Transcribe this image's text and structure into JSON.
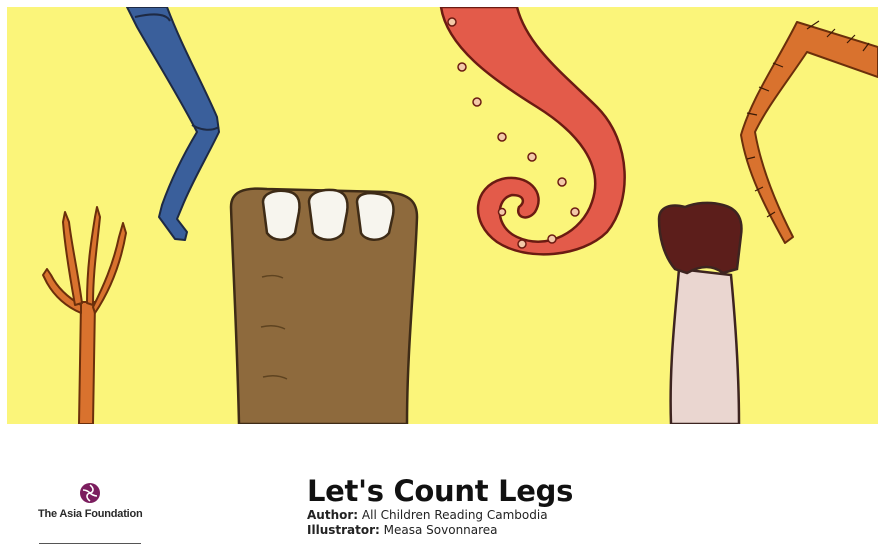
{
  "book": {
    "title": "Let's Count Legs",
    "author_label": "Author:",
    "author": "All Children Reading Cambodia",
    "illustrator_label": "Illustrator:",
    "illustrator": "Measa Sovonnarea"
  },
  "publisher": {
    "name": "The Asia Foundation",
    "mark_color": "#7b1d5e"
  },
  "cover": {
    "background_color": "#fbf57a",
    "legs": [
      "human-leg",
      "bird-foot",
      "elephant-foot",
      "octopus-tentacle",
      "hoofed-leg",
      "insect-leg"
    ]
  }
}
